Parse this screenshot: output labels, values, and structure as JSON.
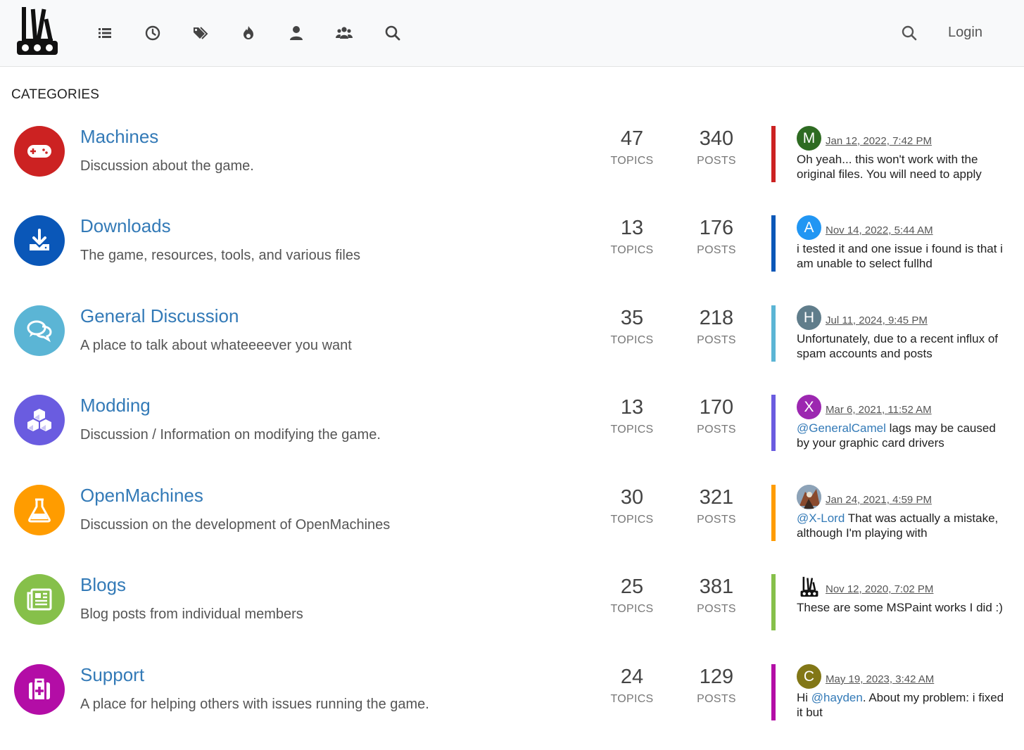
{
  "nav": {
    "login_label": "Login"
  },
  "page": {
    "heading": "CATEGORIES"
  },
  "categories": [
    {
      "title": "Machines",
      "description": "Discussion about the game.",
      "topics": "47",
      "posts": "340",
      "topics_label": "TOPICS",
      "posts_label": "POSTS",
      "color": "#cc2222",
      "icon": "gamepad-icon",
      "teaser": {
        "avatar_letter": "M",
        "avatar_color": "#2e6b22",
        "time": "Jan 12, 2022, 7:42 PM",
        "mention": "",
        "text": "Oh yeah... this won't work with the original files. You will need to apply"
      }
    },
    {
      "title": "Downloads",
      "description": "The game, resources, tools, and various files",
      "topics": "13",
      "posts": "176",
      "topics_label": "TOPICS",
      "posts_label": "POSTS",
      "color": "#0a57b8",
      "icon": "download-icon",
      "teaser": {
        "avatar_letter": "A",
        "avatar_color": "#2196f3",
        "time": "Nov 14, 2022, 5:44 AM",
        "mention": "",
        "text": "i tested it and one issue i found is that i am unable to select fullhd"
      }
    },
    {
      "title": "General Discussion",
      "description": "A place to talk about whateeeever you want",
      "topics": "35",
      "posts": "218",
      "topics_label": "TOPICS",
      "posts_label": "POSTS",
      "color": "#5bb5d5",
      "icon": "comments-icon",
      "teaser": {
        "avatar_letter": "H",
        "avatar_color": "#607d8b",
        "time": "Jul 11, 2024, 9:45 PM",
        "mention": "",
        "text": "Unfortunately, due to a recent influx of spam accounts and posts"
      }
    },
    {
      "title": "Modding",
      "description": "Discussion / Information on modifying the game.",
      "topics": "13",
      "posts": "170",
      "topics_label": "TOPICS",
      "posts_label": "POSTS",
      "color": "#6a5ce0",
      "icon": "cubes-icon",
      "teaser": {
        "avatar_letter": "X",
        "avatar_color": "#9c27b0",
        "time": "Mar 6, 2021, 11:52 AM",
        "mention": "@GeneralCamel",
        "text": " lags may be caused by your graphic card drivers"
      }
    },
    {
      "title": "OpenMachines",
      "description": "Discussion on the development of OpenMachines",
      "topics": "30",
      "posts": "321",
      "topics_label": "TOPICS",
      "posts_label": "POSTS",
      "color": "#ff9c00",
      "icon": "flask-icon",
      "teaser": {
        "avatar_letter": "",
        "avatar_color": "#7a8ca0",
        "time": "Jan 24, 2021, 4:59 PM",
        "mention": "@X-Lord",
        "text": " That was actually a mistake, although I'm playing with"
      }
    },
    {
      "title": "Blogs",
      "description": "Blog posts from individual members",
      "topics": "25",
      "posts": "381",
      "topics_label": "TOPICS",
      "posts_label": "POSTS",
      "color": "#86c04a",
      "icon": "newspaper-icon",
      "teaser": {
        "avatar_letter": "",
        "avatar_color": "#ffffff",
        "time": "Nov 12, 2020, 7:02 PM",
        "mention": "",
        "text": "These are some MSPaint works I did :)"
      }
    },
    {
      "title": "Support",
      "description": "A place for helping others with issues running the game.",
      "topics": "24",
      "posts": "129",
      "topics_label": "TOPICS",
      "posts_label": "POSTS",
      "color": "#b30da6",
      "icon": "medkit-icon",
      "teaser": {
        "avatar_letter": "C",
        "avatar_color": "#827717",
        "time": "May 19, 2023, 3:42 AM",
        "mention": "@hayden",
        "text_prefix": "Hi ",
        "text": ". About my problem: i fixed it but"
      }
    }
  ]
}
